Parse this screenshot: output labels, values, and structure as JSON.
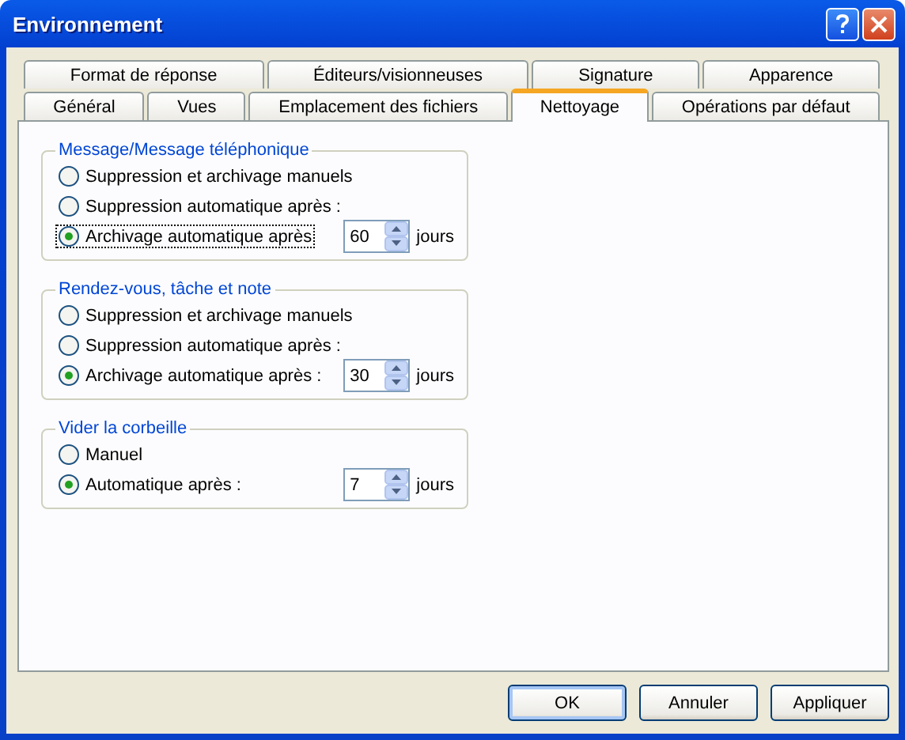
{
  "window": {
    "title": "Environnement"
  },
  "tab_rows": [
    [
      {
        "label": "Format de réponse",
        "selected": false
      },
      {
        "label": "Éditeurs/visionneuses",
        "selected": false
      },
      {
        "label": "Signature",
        "selected": false
      },
      {
        "label": "Apparence",
        "selected": false
      }
    ],
    [
      {
        "label": "Général",
        "selected": false
      },
      {
        "label": "Vues",
        "selected": false
      },
      {
        "label": "Emplacement des fichiers",
        "selected": false
      },
      {
        "label": "Nettoyage",
        "selected": true
      },
      {
        "label": "Opérations par défaut",
        "selected": false
      }
    ]
  ],
  "groups": [
    {
      "title": "Message/Message téléphonique",
      "options": [
        {
          "label": "Suppression et archivage manuels",
          "selected": false,
          "focused": false
        },
        {
          "label": "Suppression automatique après :",
          "selected": false,
          "focused": false
        },
        {
          "label": "Archivage automatique après",
          "selected": true,
          "focused": true
        }
      ],
      "spin": {
        "value": "60",
        "unit": "jours"
      }
    },
    {
      "title": "Rendez-vous, tâche et note",
      "options": [
        {
          "label": "Suppression et archivage manuels",
          "selected": false,
          "focused": false
        },
        {
          "label": "Suppression automatique après :",
          "selected": false,
          "focused": false
        },
        {
          "label": "Archivage automatique après :",
          "selected": true,
          "focused": false
        }
      ],
      "spin": {
        "value": "30",
        "unit": "jours"
      }
    },
    {
      "title": "Vider la corbeille",
      "options": [
        {
          "label": "Manuel",
          "selected": false,
          "focused": false
        },
        {
          "label": "Automatique après :",
          "selected": true,
          "focused": false
        }
      ],
      "spin": {
        "value": "7",
        "unit": "jours"
      }
    }
  ],
  "buttons": [
    {
      "label": "OK",
      "default": true
    },
    {
      "label": "Annuler",
      "default": false
    },
    {
      "label": "Appliquer",
      "default": false
    }
  ]
}
